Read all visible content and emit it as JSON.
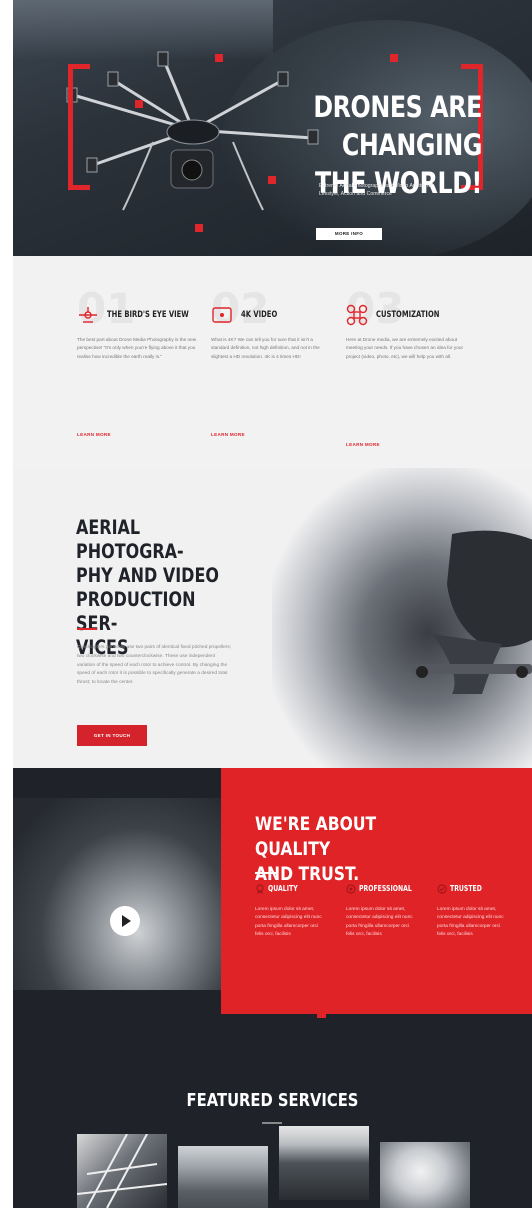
{
  "hero": {
    "title_line1": "DRONES ARE CHANGING",
    "title_line2": "THE WORLD!",
    "subtitle": "Extreme Aerial Photography and Video Artistry for Lifestyle, Action and Commerce",
    "button": "MORE INFO",
    "accent": "#e0252b"
  },
  "features": [
    {
      "number": "01",
      "icon": "drone-propeller-icon",
      "title": "THE BIRD'S EYE VIEW",
      "text": "The best part about Drone Media Photography is the new perspective! \"It's only when you're flying above it that you realise how incredible the earth really is.\"",
      "link": "LEARN MORE"
    },
    {
      "number": "02",
      "icon": "camera-4k-icon",
      "title": "4K VIDEO",
      "text": "What is 4K? We can tell you for sure that it isn't a standard definition, not high definition, and not in the slightest a HD resolution. 4K is 4 times HD!",
      "link": "LEARN MORE"
    },
    {
      "number": "03",
      "icon": "drone-top-icon",
      "title": "CUSTOMIZATION",
      "text": "Here at Drone media, we are extremely excited about meeting your needs. If you have chosen an idea for your project (video, photo, etc), we will help you with all.",
      "link": "LEARN MORE"
    }
  ],
  "aerial": {
    "title": "AERIAL PHOTOGRA-PHY AND VIDEO PRODUCTION SER-VICES",
    "title_lines": [
      "AERIAL PHOTOGRA-",
      "PHY AND VIDEO",
      "PRODUCTION SER-",
      "VICES"
    ],
    "text": "Quadcopters generally use two pairs of identical fixed pitched propellers; two clockwise and two counterclockwise. These use independent variation of the speed of each rotor to achieve control. By changing the speed of each rotor it is possible to specifically generate a desired total thrust; to locate the center.",
    "button": "GET IN TOUCH"
  },
  "quality": {
    "title_line1": "WE'RE ABOUT QUALITY",
    "title_line2": "AND TRUST.",
    "columns": [
      {
        "icon": "quality-icon",
        "title": "QUALITY",
        "text": "Lorem ipsum dolor sit amet, consectetur adipiscing elit nunc porta fringilla ullamcorper orci felis orci, facilisis"
      },
      {
        "icon": "professional-icon",
        "title": "PROFESSIONAL",
        "text": "Lorem ipsum dolor sit amet, consectetur adipiscing elit nunc porta fringilla ullamcorper orci felis orci, facilisis"
      },
      {
        "icon": "trusted-icon",
        "title": "TRUSTED",
        "text": "Lorem ipsum dolor sit amet, consectetur adipiscing elit nunc porta fringilla ullamcorper orci felis orci, facilisis"
      }
    ]
  },
  "featured": {
    "title": "FEATURED SERVICES"
  }
}
